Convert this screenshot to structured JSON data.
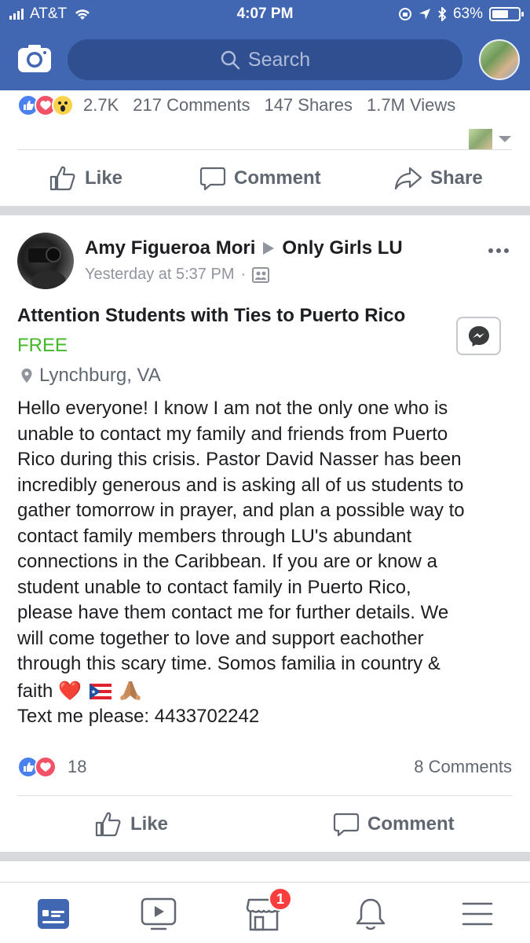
{
  "status_bar": {
    "carrier": "AT&T",
    "time": "4:07 PM",
    "battery": "63%",
    "battery_level": 0.63
  },
  "header": {
    "search_placeholder": "Search",
    "camera_icon": "camera-icon",
    "profile_icon": "profile-avatar"
  },
  "previous_post": {
    "reactions": [
      "like",
      "love",
      "wow"
    ],
    "reaction_count": "2.7K",
    "comments": "217 Comments",
    "shares": "147 Shares",
    "views": "1.7M Views",
    "actions": {
      "like": "Like",
      "comment": "Comment",
      "share": "Share"
    }
  },
  "post": {
    "author": "Amy Figueroa Mori",
    "group": "Only Girls LU",
    "time": "Yesterday at 5:37 PM",
    "separator": "·",
    "item_title": "Attention Students with Ties to Puerto Rico",
    "price": "FREE",
    "location": "Lynchburg, VA",
    "body_lines": [
      "Hello everyone! I know I am not the only one who is",
      "unable to contact my family and friends from Puerto",
      "Rico during this crisis. Pastor David Nasser has been",
      "incredibly generous and is asking all of us students to",
      "gather tomorrow in prayer, and plan a possible way to",
      "contact family members through LU's abundant",
      "connections in the Caribbean. If you are or know a",
      "student unable to contact family in Puerto Rico,",
      "please have them contact me for further details. We",
      "will come together to love and support eachother",
      "through this scary time. Somos familia in country &"
    ],
    "body_last_word": "faith",
    "heart_emoji": "❤️",
    "text_me": "Text me please: 4433702242",
    "reactions": [
      "like",
      "love"
    ],
    "reaction_count": "18",
    "comments": "8 Comments",
    "actions": {
      "like": "Like",
      "comment": "Comment"
    }
  },
  "tab_bar": {
    "tabs": [
      "news-feed",
      "watch",
      "marketplace",
      "notifications",
      "menu"
    ],
    "marketplace_badge": "1",
    "active_color": "#4267b2"
  },
  "colors": {
    "brand": "#4267b2",
    "price": "#42b72a",
    "like": "#4a80f0",
    "love": "#f25268"
  }
}
